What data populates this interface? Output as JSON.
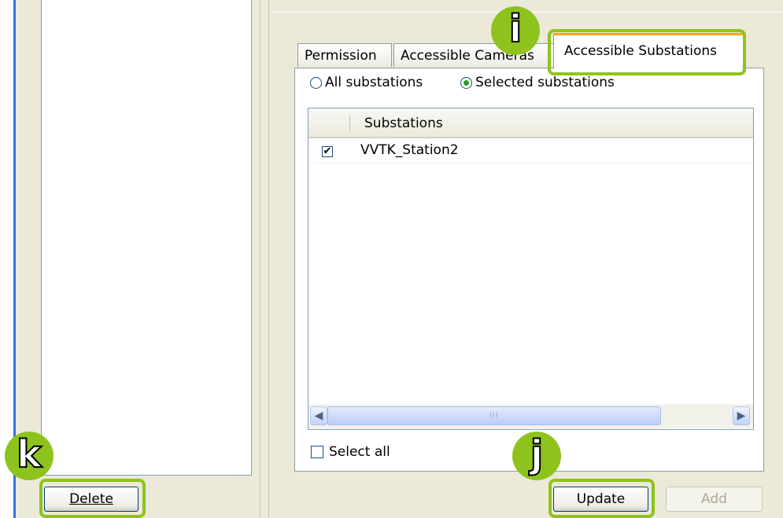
{
  "tabs": [
    {
      "label": "Permission"
    },
    {
      "label": "Accessible Cameras"
    },
    {
      "label": "Accessible Substations"
    }
  ],
  "scope": {
    "all_label": "All substations",
    "selected_label": "Selected substations",
    "selected": "selected"
  },
  "list": {
    "header": "Substations",
    "rows": [
      {
        "checked": true,
        "name": "VVTK_Station2"
      }
    ]
  },
  "scrollbar": {
    "grip": "III"
  },
  "select_all_label": "Select all",
  "buttons": {
    "delete": "Delete",
    "update": "Update",
    "add": "Add"
  },
  "callouts": {
    "i": "i",
    "j": "j",
    "k": "k"
  },
  "colors": {
    "highlight": "#8ec31e",
    "active_tab_accent": "#f5a623"
  }
}
